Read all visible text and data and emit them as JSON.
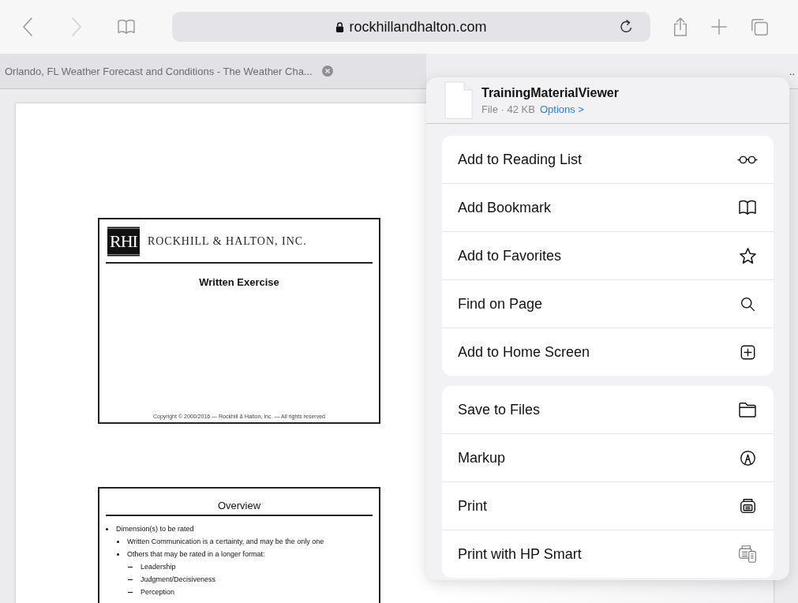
{
  "toolbar": {
    "back": {
      "disabled": false
    },
    "forward": {
      "disabled": true
    },
    "url": "rockhillandhalton.com"
  },
  "tabs": [
    {
      "title": "Orlando, FL Weather Forecast and Conditions - The Weather Cha...",
      "selected": false
    },
    {
      "title": "..",
      "selected": true
    }
  ],
  "document": {
    "slides": [
      {
        "kind": "title",
        "logo": "RHI",
        "company": "ROCKHILL & HALTON, INC.",
        "heading": "Written Exercise",
        "footer": "Copyright © 2000/2016 — Rockhill & Halton, Inc. — All rights reserved"
      },
      {
        "kind": "bullets",
        "heading": "Overview",
        "items": [
          {
            "text": "Dimension(s) to be rated",
            "children": [
              {
                "text": "Written Communication is a certainty, and may be the only one"
              },
              {
                "text": "Others that may be rated in a longer format:",
                "children": [
                  {
                    "text": "Leadership"
                  },
                  {
                    "text": "Judgment/Decisiveness"
                  },
                  {
                    "text": "Perception"
                  }
                ]
              }
            ]
          }
        ]
      }
    ]
  },
  "share_sheet": {
    "file": {
      "name": "TrainingMaterialViewer",
      "info": "File · 42 KB",
      "options": "Options >"
    },
    "groups": [
      [
        {
          "label": "Add to Reading List"
        },
        {
          "label": "Add Bookmark"
        },
        {
          "label": "Add to Favorites"
        },
        {
          "label": "Find on Page"
        },
        {
          "label": "Add to Home Screen"
        }
      ],
      [
        {
          "label": "Save to Files"
        },
        {
          "label": "Markup"
        },
        {
          "label": "Print"
        },
        {
          "label": "Print with HP Smart"
        }
      ]
    ]
  }
}
